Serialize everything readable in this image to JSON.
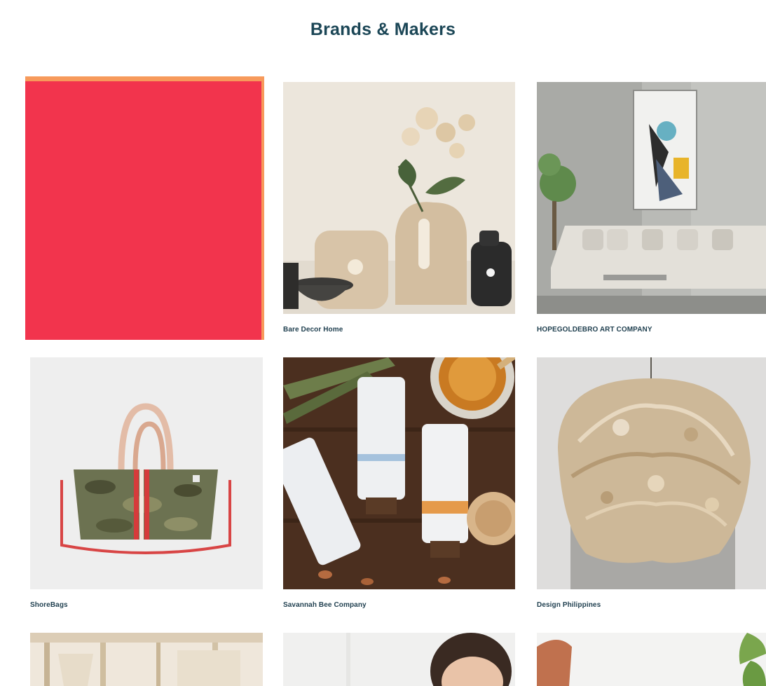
{
  "page": {
    "title": "Brands & Makers"
  },
  "colors": {
    "title": "#1b4656",
    "caption": "#1f3f4f",
    "swatch_red": "#f2344d",
    "swatch_orange": "#f79a5b"
  },
  "brands": [
    {
      "name": "",
      "image": "red-color-swatch"
    },
    {
      "name": "Bare Decor Home",
      "image": "ceramic-vases-with-orchid-photo"
    },
    {
      "name": "HOPEGOLDEBRO ART COMPANY",
      "image": "living-room-with-abstract-art-photo"
    },
    {
      "name": "ShoreBags",
      "image": "camo-tote-bag-photo"
    },
    {
      "name": "Savannah Bee Company",
      "image": "honey-skincare-tubes-photo"
    },
    {
      "name": "Design Philippines",
      "image": "capiz-pendant-lamp-photo"
    },
    {
      "name": "",
      "image": "bright-interior-room-photo"
    },
    {
      "name": "",
      "image": "woman-portrait-photo"
    },
    {
      "name": "",
      "image": "hand-with-plant-photo"
    }
  ]
}
